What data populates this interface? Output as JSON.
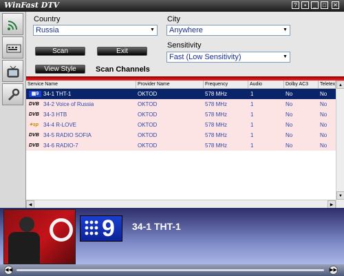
{
  "window": {
    "title": "WinFast DTV"
  },
  "form": {
    "country_label": "Country",
    "country_value": "Russia",
    "city_label": "City",
    "city_value": "Anywhere",
    "sensitivity_label": "Sensitivity",
    "sensitivity_value": "Fast (Low Sensitivity)",
    "scan_button": "Scan",
    "exit_button": "Exit",
    "view_style_button": "View Style",
    "scan_channels_label": "Scan Channels"
  },
  "table": {
    "columns": [
      "Service Name",
      "Provider Name",
      "Frequency",
      "Audio",
      "Dolby AC3",
      "Teletext"
    ],
    "rows": [
      {
        "logo": "tv9",
        "service": "34-1 THT-1",
        "provider": "OKTOD",
        "frequency": "578 MHz",
        "audio": "1",
        "dolby": "No",
        "teletext": "No",
        "selected": true
      },
      {
        "logo": "DVB",
        "service": "34-2 Voice of Russia",
        "provider": "OKTOD",
        "frequency": "578 MHz",
        "audio": "1",
        "dolby": "No",
        "teletext": "No",
        "selected": false
      },
      {
        "logo": "DVB",
        "service": "34-3 HTB",
        "provider": "OKTOD",
        "frequency": "578 MHz",
        "audio": "1",
        "dolby": "No",
        "teletext": "No",
        "selected": false
      },
      {
        "logo": "sport",
        "service": "34-4 R-LOVE",
        "provider": "OKTOD",
        "frequency": "578 MHz",
        "audio": "1",
        "dolby": "No",
        "teletext": "No",
        "selected": false
      },
      {
        "logo": "DVB",
        "service": "34-5 RADIO SOFIA",
        "provider": "OKTOD",
        "frequency": "578 MHz",
        "audio": "1",
        "dolby": "No",
        "teletext": "No",
        "selected": false
      },
      {
        "logo": "DVB",
        "service": "34-6 RADIO-7",
        "provider": "OKTOD",
        "frequency": "578 MHz",
        "audio": "1",
        "dolby": "No",
        "teletext": "No",
        "selected": false
      }
    ]
  },
  "now_playing": {
    "channel": "34-1 THT-1",
    "logo_text": "9"
  },
  "colors": {
    "accent_red": "#e01010",
    "selection": "#0a246a",
    "row_bg": "#fde4e4"
  }
}
